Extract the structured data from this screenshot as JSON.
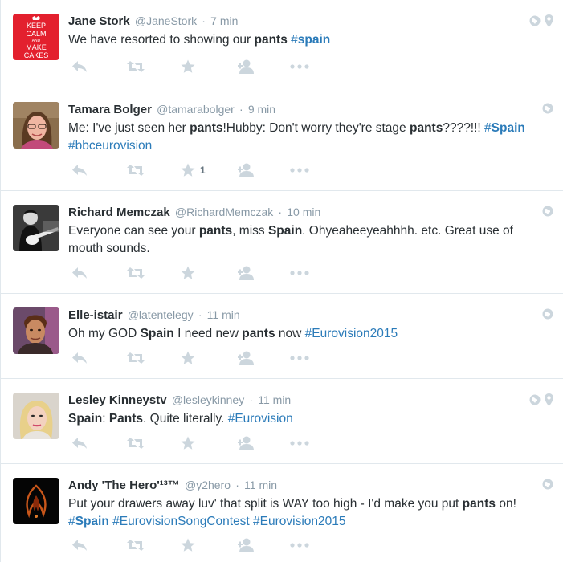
{
  "colors": {
    "link": "#2b7bb9",
    "icon": "#ccd6dd",
    "meta": "#8899a6",
    "text": "#292f33"
  },
  "action_icons": [
    "reply-icon",
    "retweet-icon",
    "favorite-icon",
    "follow-icon",
    "more-icon"
  ],
  "tweets": [
    {
      "name": "Jane Stork",
      "handle": "@JaneStork",
      "sep": "·",
      "time": "7 min",
      "avatar_icon": "keep-calm-avatar",
      "avatar_lines": [
        "KEEP",
        "CALM",
        "AND",
        "MAKE",
        "CAKES"
      ],
      "geo": true,
      "text": [
        {
          "t": "We have resorted to showing our "
        },
        {
          "t": "pants",
          "b": true
        },
        {
          "t": " "
        },
        {
          "t": "#",
          "tag": true
        },
        {
          "t": "spain",
          "tag": true,
          "b": true
        }
      ],
      "favorites": ""
    },
    {
      "name": "Tamara Bolger",
      "handle": "@tamarabolger",
      "sep": "·",
      "time": "9 min",
      "avatar_icon": "woman-glasses-avatar",
      "geo": false,
      "text": [
        {
          "t": "Me: I've just seen her "
        },
        {
          "t": "pants",
          "b": true
        },
        {
          "t": "!Hubby: Don't worry they're stage "
        },
        {
          "t": "pants",
          "b": true
        },
        {
          "t": "????!!! "
        },
        {
          "t": "#",
          "tag": true
        },
        {
          "t": "Spain",
          "tag": true,
          "b": true
        },
        {
          "t": " #bbceurovision",
          "tag": true
        }
      ],
      "favorites": "1"
    },
    {
      "name": "Richard Memczak",
      "handle": "@RichardMemczak",
      "sep": "·",
      "time": "10 min",
      "avatar_icon": "guitarist-avatar",
      "geo": false,
      "text": [
        {
          "t": "Everyone can see your "
        },
        {
          "t": "pants",
          "b": true
        },
        {
          "t": ", miss "
        },
        {
          "t": "Spain",
          "b": true
        },
        {
          "t": ". Ohyeaheeyeahhhh. etc. Great use of mouth sounds."
        }
      ],
      "favorites": ""
    },
    {
      "name": "Elle-istair",
      "handle": "@latentelegy",
      "sep": "·",
      "time": "11 min",
      "avatar_icon": "game-character-avatar",
      "geo": false,
      "text": [
        {
          "t": "Oh my GOD "
        },
        {
          "t": "Spain",
          "b": true
        },
        {
          "t": " I need new "
        },
        {
          "t": "pants",
          "b": true
        },
        {
          "t": " now "
        },
        {
          "t": "#Eurovision2015",
          "tag": true
        }
      ],
      "favorites": ""
    },
    {
      "name": "Lesley Kinneystv",
      "handle": "@lesleykinney",
      "sep": "·",
      "time": "11 min",
      "avatar_icon": "blonde-woman-avatar",
      "geo": true,
      "text": [
        {
          "t": "Spain",
          "b": true
        },
        {
          "t": ": "
        },
        {
          "t": "Pants",
          "b": true
        },
        {
          "t": ". Quite literally. "
        },
        {
          "t": "#Eurovision",
          "tag": true
        }
      ],
      "favorites": ""
    },
    {
      "name": "Andy 'The Hero'¹³™",
      "handle": "@y2hero",
      "sep": "·",
      "time": "11 min",
      "avatar_icon": "dark-flame-avatar",
      "geo": false,
      "text": [
        {
          "t": "Put your drawers away luv' that split is WAY too high - I'd make you put "
        },
        {
          "t": "pants",
          "b": true
        },
        {
          "t": " on! "
        },
        {
          "t": "#",
          "tag": true
        },
        {
          "t": "Spain",
          "tag": true,
          "b": true
        },
        {
          "t": " #EurovisionSongContest #Eurovision2015",
          "tag": true
        }
      ],
      "favorites": ""
    }
  ]
}
